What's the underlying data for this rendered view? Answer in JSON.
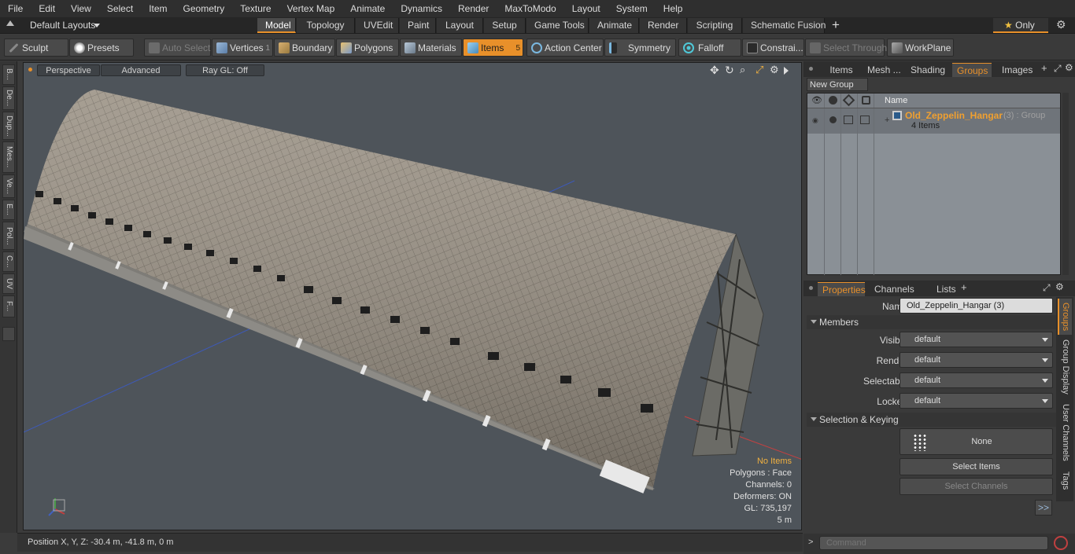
{
  "menu": [
    "File",
    "Edit",
    "View",
    "Select",
    "Item",
    "Geometry",
    "Texture",
    "Vertex Map",
    "Animate",
    "Dynamics",
    "Render",
    "MaxToModo",
    "Layout",
    "System",
    "Help"
  ],
  "layout_bar": {
    "layouts_label": "Default Layouts",
    "tabs": [
      "Model",
      "Topology",
      "UVEdit",
      "Paint",
      "Layout",
      "Setup",
      "Game Tools",
      "Animate",
      "Render",
      "Scripting",
      "Schematic Fusion"
    ],
    "only_label": "Only"
  },
  "toolbar": {
    "sculpt": "Sculpt",
    "presets": "Presets",
    "auto_select": "Auto Select",
    "vertices": "Vertices",
    "vertices_count": "1",
    "boundary": "Boundary",
    "polygons": "Polygons",
    "materials": "Materials",
    "items": "Items",
    "items_count": "5",
    "action_center": "Action Center",
    "symmetry": "Symmetry",
    "falloff": "Falloff",
    "constraints": "Constrai...",
    "select_through": "Select Through",
    "workplane": "WorkPlane"
  },
  "left_tools": [
    "B...",
    "De...",
    "Dup...",
    "Mes...",
    "Ve...",
    "E...",
    "Pol...",
    "C...",
    "UV",
    "F..."
  ],
  "viewport": {
    "view_mode": "Perspective",
    "shading": "Advanced",
    "raygl": "Ray GL: Off",
    "info": {
      "items": "No Items",
      "polygons": "Polygons : Face",
      "channels": "Channels: 0",
      "deformers": "Deformers: ON",
      "gl": "GL: 735,197",
      "scale": "5 m"
    }
  },
  "status": {
    "position": "Position X, Y, Z:  -30.4 m, -41.8 m, 0 m"
  },
  "right_top_tabs": [
    "Items",
    "Mesh ...",
    "Shading",
    "Groups",
    "Images"
  ],
  "groups": {
    "new_group": "New Group",
    "col_name": "Name",
    "group_name": "Old_Zeppelin_Hangar",
    "group_suffix": "(3) : Group",
    "group_items": "4 Items"
  },
  "properties_tabs": [
    "Properties",
    "Channels",
    "Lists"
  ],
  "properties": {
    "name_label": "Name",
    "name_value": "Old_Zeppelin_Hangar (3)",
    "members": "Members",
    "visible_label": "Visible",
    "visible_value": "default",
    "render_label": "Render",
    "render_value": "default",
    "selectable_label": "Selectable",
    "selectable_value": "default",
    "locked_label": "Locked",
    "locked_value": "default",
    "selection_keying": "Selection & Keying",
    "none_label": "None",
    "select_items": "Select Items",
    "select_channels": "Select Channels",
    "more": ">>"
  },
  "side_tabs": [
    "Groups",
    "Group Display",
    "User Channels",
    "Tags"
  ],
  "command": {
    "placeholder": "Command",
    "prompt": ">"
  },
  "colors": {
    "accent": "#e8902a",
    "background": "#3b3b3b",
    "viewport": "#4e545a"
  }
}
